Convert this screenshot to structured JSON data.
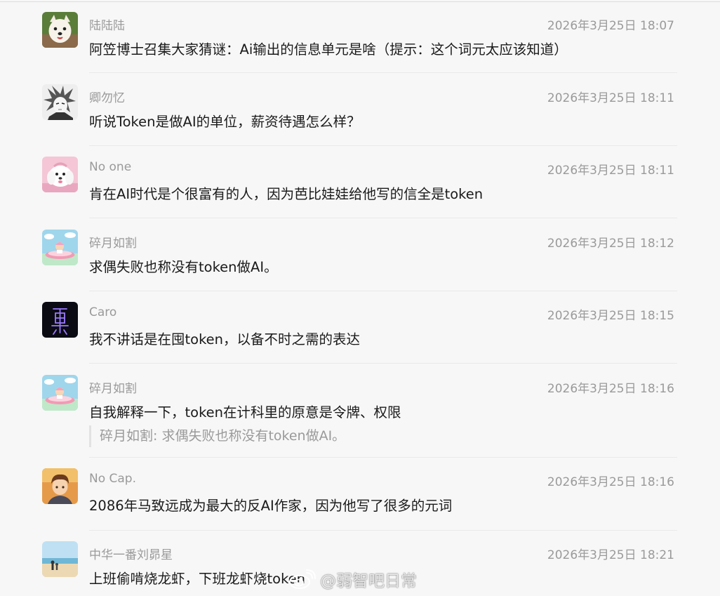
{
  "messages": [
    {
      "name": "陆陆陆",
      "time": "2026年3月25日 18:07",
      "text": "阿笠博士召集大家猜谜：Ai输出的信息单元是啥（提示：这个词元太应该知道）",
      "avatar": "white-dog-avatar"
    },
    {
      "name": "卿勿忆",
      "time": "2026年3月25日 18:11",
      "text": "听说Token是做AI的单位，薪资待遇怎么样？",
      "avatar": "manga-character-avatar"
    },
    {
      "name": "No one",
      "time": "2026年3月25日 18:11",
      "text": "肯在AI时代是个很富有的人，因为芭比娃娃给他写的信全是token",
      "avatar": "white-puppy-avatar"
    },
    {
      "name": "碎月如割",
      "time": "2026年3月25日 18:12",
      "text": "求偶失败也称没有token做AI。",
      "avatar": "pink-cartoon-boat-avatar"
    },
    {
      "name": "Caro",
      "time": "2026年3月25日 18:15",
      "text": "我不讲话是在囤token，以备不时之需的表达",
      "avatar": "neon-glyph-avatar"
    },
    {
      "name": "碎月如割",
      "time": "2026年3月25日 18:16",
      "text": "自我解释一下，token在计科里的原意是令牌、权限",
      "quote": "碎月如割: 求偶失败也称没有token做AI。",
      "avatar": "pink-cartoon-boat-avatar"
    },
    {
      "name": "No Cap.",
      "time": "2026年3月25日 18:16",
      "text": "2086年马致远成为最大的反AI作家，因为他写了很多的元词",
      "avatar": "anime-boy-avatar"
    },
    {
      "name": "中华一番刘昴星",
      "time": "2026年3月25日 18:21",
      "text": "上班偷啃烧龙虾，下班龙虾烧token",
      "avatar": "beach-photo-avatar"
    }
  ],
  "watermark": {
    "text": "@弱智吧日常",
    "icon": "weibo-logo-icon"
  }
}
